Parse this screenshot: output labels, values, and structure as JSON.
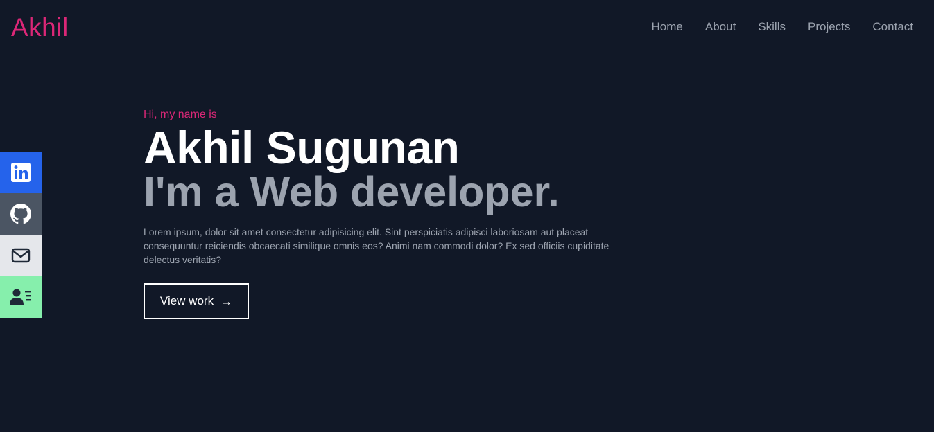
{
  "colors": {
    "background": "#111827",
    "accent": "#db2777",
    "nav_text": "#9ca3af",
    "linkedin_bg": "#2563eb",
    "github_bg": "#4b5563",
    "email_bg": "#e5e7eb",
    "resume_bg": "#86efac"
  },
  "header": {
    "logo": "Akhil",
    "nav": [
      {
        "label": "Home"
      },
      {
        "label": "About"
      },
      {
        "label": "Skills"
      },
      {
        "label": "Projects"
      },
      {
        "label": "Contact"
      }
    ]
  },
  "social": [
    {
      "icon": "linkedin-icon"
    },
    {
      "icon": "github-icon"
    },
    {
      "icon": "mail-icon"
    },
    {
      "icon": "resume-icon"
    }
  ],
  "hero": {
    "greeting": "Hi, my name is",
    "name": "Akhil Sugunan",
    "role": "I'm a Web developer.",
    "description": "Lorem ipsum, dolor sit amet consectetur adipisicing elit. Sint perspiciatis adipisci laboriosam aut placeat consequuntur reiciendis obcaecati similique omnis eos? Animi nam commodi dolor? Ex sed officiis cupiditate delectus veritatis?",
    "cta_label": "View work",
    "cta_icon": "arrow-right-icon"
  }
}
